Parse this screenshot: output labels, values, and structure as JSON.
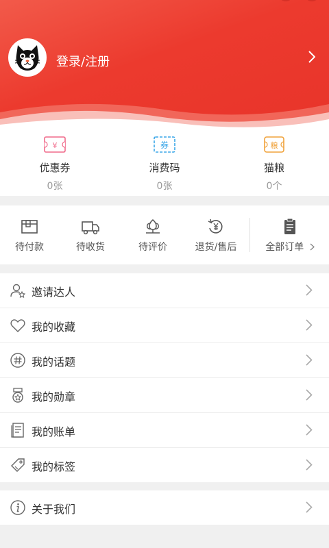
{
  "header": {
    "login_label": "登录/注册",
    "avatar_icon": "cat-avatar-icon",
    "accent_color": "#e8342a"
  },
  "assets": [
    {
      "label": "优惠券",
      "count": "0张",
      "icon": "coupon-icon"
    },
    {
      "label": "消费码",
      "count": "0张",
      "icon": "voucher-code-icon"
    },
    {
      "label": "猫粮",
      "count": "0个",
      "icon": "cat-food-icon"
    }
  ],
  "coupon_glyph": "¥",
  "voucher_glyph": "券",
  "catfood_glyph": "粮",
  "orders": [
    {
      "label": "待付款",
      "icon": "pending-payment-icon"
    },
    {
      "label": "待收货",
      "icon": "truck-icon"
    },
    {
      "label": "待评价",
      "icon": "flower-review-icon"
    },
    {
      "label": "退货/售后",
      "icon": "refund-icon"
    },
    {
      "label": "全部订单",
      "icon": "clipboard-icon"
    }
  ],
  "menu": [
    {
      "label": "邀请达人",
      "icon": "invite-user-icon"
    },
    {
      "label": "我的收藏",
      "icon": "heart-icon"
    },
    {
      "label": "我的话题",
      "icon": "hashtag-icon"
    },
    {
      "label": "我的勋章",
      "icon": "medal-icon"
    },
    {
      "label": "我的账单",
      "icon": "bill-icon"
    },
    {
      "label": "我的标签",
      "icon": "tag-icon"
    }
  ],
  "about": {
    "label": "关于我们",
    "icon": "info-icon"
  }
}
